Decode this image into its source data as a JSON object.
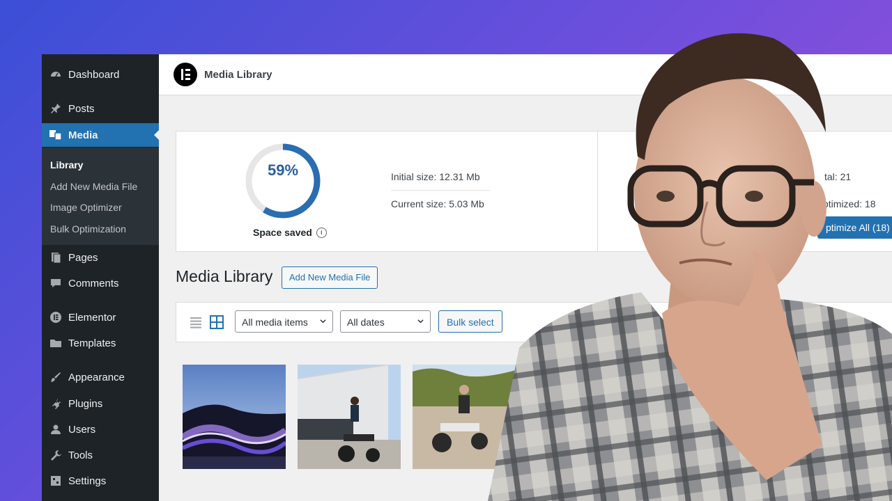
{
  "sidebar": {
    "items": [
      {
        "label": "Dashboard",
        "icon": "dashboard-icon"
      },
      {
        "label": "Posts",
        "icon": "pin-icon"
      },
      {
        "label": "Media",
        "icon": "media-icon",
        "active": true
      },
      {
        "label": "Pages",
        "icon": "pages-icon"
      },
      {
        "label": "Comments",
        "icon": "comment-icon"
      },
      {
        "label": "Elementor",
        "icon": "elementor-icon"
      },
      {
        "label": "Templates",
        "icon": "folder-icon"
      },
      {
        "label": "Appearance",
        "icon": "brush-icon"
      },
      {
        "label": "Plugins",
        "icon": "plug-icon"
      },
      {
        "label": "Users",
        "icon": "user-icon"
      },
      {
        "label": "Tools",
        "icon": "wrench-icon"
      },
      {
        "label": "Settings",
        "icon": "settings-icon"
      }
    ],
    "submenu": [
      {
        "label": "Library",
        "current": true
      },
      {
        "label": "Add New Media File"
      },
      {
        "label": "Image Optimizer"
      },
      {
        "label": "Bulk Optimization"
      }
    ]
  },
  "topbar": {
    "title": "Media Library"
  },
  "stats": {
    "percent": 59,
    "percent_label": "59%",
    "space_saved_label": "Space saved",
    "initial_size": "Initial size: 12.31 Mb",
    "current_size": "Current size: 5.03 Mb",
    "total_partial": "tal: 21",
    "optimized_partial": "ptimized: 18",
    "optimize_all_partial": "ptimize All (18)"
  },
  "library": {
    "title": "Media Library",
    "add_new_label": "Add New Media File"
  },
  "filters": {
    "media_type": "All media items",
    "dates": "All dates",
    "bulk_select_label": "Bulk select"
  },
  "colors": {
    "accent": "#2271b1",
    "sidebar_bg": "#1d2327",
    "ring_track": "#e6e6e6",
    "ring_fill": "#2a6db0"
  }
}
